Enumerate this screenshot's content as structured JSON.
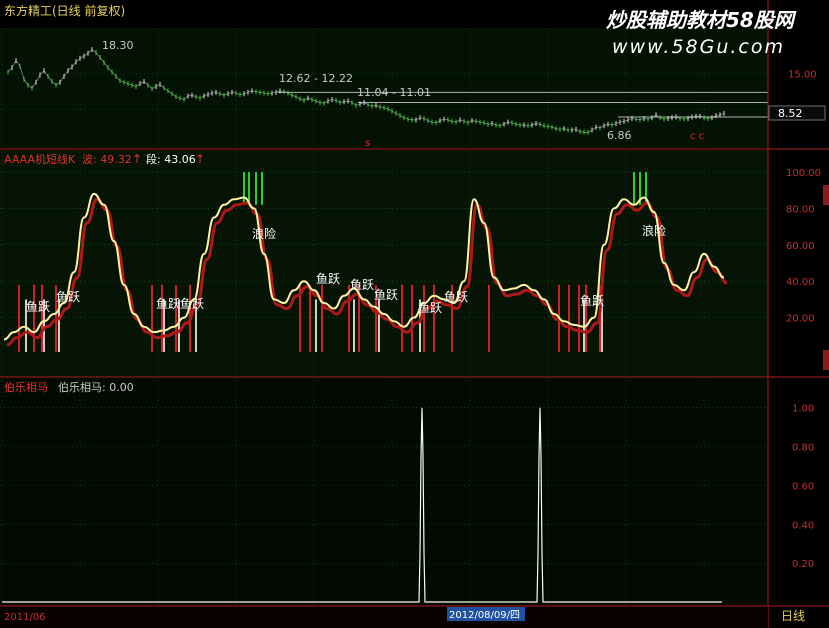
{
  "header": {
    "stock_title": "东方精工(日线 前复权)",
    "watermark_title": "炒股辅助教材58股网",
    "watermark_url": "www.58Gu.com"
  },
  "colors": {
    "background": "#000000",
    "panel_bg": "#051405",
    "grid": "#1f5a1f",
    "border": "#8b1a1a",
    "axis_text": "#c03030",
    "price_line": "#c8c8c8",
    "osc_main": "#fff3a0",
    "osc_shadow": "#b01818",
    "green_bar": "#33ff33",
    "white_bar": "#ffffff",
    "red_bar": "#d02020",
    "osc_label": "#e03030",
    "signal_line": "#f0fff0"
  },
  "price_panel": {
    "annotations": [
      {
        "id": "high",
        "text": "18.30"
      },
      {
        "id": "range1",
        "text": "12.62 - 12.22"
      },
      {
        "id": "range2",
        "text": "11.04 - 11.01"
      },
      {
        "id": "low",
        "text": "6.86"
      },
      {
        "id": "last",
        "text": "8.52"
      }
    ],
    "y_ticks": [
      "15.00",
      "10.00"
    ],
    "ylim": [
      5,
      21
    ]
  },
  "osc_panel": {
    "indicator_name": "AAAA机短线K",
    "indicator_label_value": "波: 49.32",
    "segment_label": "段: 43.06",
    "y_ticks": [
      "100.00",
      "80.00",
      "60.00",
      "40.00",
      "20.00"
    ],
    "ylim": [
      0,
      100
    ],
    "labels": [
      {
        "text": "鱼跃"
      },
      {
        "text": "鱼跃"
      },
      {
        "text": "鱼跃"
      },
      {
        "text": "鱼跃"
      },
      {
        "text": "浪险"
      },
      {
        "text": "鱼跃"
      },
      {
        "text": "鱼跃"
      },
      {
        "text": "鱼跃"
      },
      {
        "text": "鱼跃"
      },
      {
        "text": "鱼跃"
      },
      {
        "text": "鱼跃"
      },
      {
        "text": "浪险"
      }
    ]
  },
  "signal_panel": {
    "indicator_name": "伯乐相马",
    "value_label": "伯乐相马: 0.00",
    "y_ticks": [
      "1.00",
      "0.80",
      "0.60",
      "0.40",
      "0.20"
    ],
    "ylim": [
      0,
      1.05
    ]
  },
  "footer": {
    "date_left": "2011/06",
    "date_highlight": "2012/08/09/四",
    "period": "日线"
  },
  "chart_data": [
    {
      "type": "line",
      "name": "price",
      "ylim": [
        5,
        21
      ],
      "y_ticks": [
        15,
        10
      ],
      "x": [
        0,
        4,
        8,
        12,
        16,
        20,
        24,
        28,
        32,
        36,
        40,
        44,
        48,
        52,
        56,
        60,
        64,
        68,
        72,
        76,
        80,
        84,
        88,
        92,
        96,
        100,
        104,
        108,
        112,
        116,
        120,
        124,
        128,
        132,
        136,
        140,
        144,
        148,
        152,
        156,
        160,
        164,
        168,
        172,
        176,
        180,
        184,
        188,
        192,
        196,
        200,
        204,
        208,
        212,
        216,
        220,
        224,
        228,
        232,
        236,
        240,
        244,
        248,
        252,
        256,
        260,
        264,
        268,
        272,
        276,
        280,
        284,
        288,
        292,
        296,
        300,
        304,
        308,
        312,
        316,
        320,
        324,
        328,
        332,
        336,
        340,
        344,
        348,
        352,
        356,
        360,
        364,
        368,
        372,
        376,
        380,
        384,
        388,
        392,
        396,
        400,
        404,
        408,
        412,
        416,
        420,
        424,
        428,
        432,
        436,
        440,
        444,
        448,
        452,
        456,
        460,
        464,
        468,
        472,
        476,
        480,
        484,
        488,
        492,
        496,
        500,
        504,
        508,
        512,
        516,
        520,
        524,
        528,
        532,
        536,
        540,
        544,
        548,
        552,
        556,
        560,
        564,
        568,
        572,
        576,
        580,
        584,
        588,
        592,
        596,
        600,
        604,
        608,
        612,
        616,
        620,
        624,
        628,
        632,
        636,
        640,
        644,
        648,
        652,
        656,
        660,
        664,
        668,
        672,
        676,
        680,
        684,
        688,
        692,
        696,
        700,
        704,
        708,
        712,
        716,
        720
      ],
      "values": [
        15.2,
        15.8,
        16.8,
        16.0,
        14.2,
        13.4,
        13.0,
        13.8,
        14.8,
        15.4,
        14.6,
        13.9,
        13.4,
        13.8,
        14.6,
        15.4,
        15.9,
        16.6,
        17.1,
        17.4,
        17.8,
        18.3,
        17.9,
        17.2,
        16.5,
        15.8,
        15.2,
        14.6,
        14.0,
        13.8,
        13.6,
        13.4,
        13.2,
        13.6,
        13.9,
        13.4,
        12.9,
        13.2,
        13.5,
        13.0,
        12.6,
        12.2,
        11.8,
        11.6,
        11.4,
        11.9,
        12.0,
        11.8,
        11.6,
        11.9,
        12.1,
        12.3,
        12.4,
        12.2,
        12.0,
        12.2,
        12.4,
        12.3,
        12.1,
        12.2,
        12.4,
        12.6,
        12.5,
        12.4,
        12.3,
        12.2,
        12.3,
        12.4,
        12.6,
        12.5,
        12.3,
        12.0,
        11.8,
        11.5,
        11.3,
        11.6,
        11.4,
        11.2,
        11.0,
        10.9,
        11.2,
        11.4,
        11.3,
        11.0,
        11.1,
        11.2,
        11.0,
        10.6,
        10.8,
        11.0,
        10.7,
        10.5,
        10.6,
        10.4,
        10.3,
        10.1,
        9.8,
        9.5,
        9.2,
        8.9,
        8.7,
        8.6,
        8.6,
        8.9,
        8.8,
        8.5,
        8.3,
        8.2,
        8.5,
        8.7,
        8.6,
        8.4,
        8.3,
        8.6,
        8.4,
        8.2,
        8.5,
        8.4,
        8.3,
        8.2,
        8.0,
        8.1,
        7.9,
        7.8,
        8.0,
        8.3,
        8.2,
        8.0,
        7.9,
        7.9,
        7.8,
        7.9,
        8.1,
        8.0,
        7.8,
        7.7,
        7.6,
        7.4,
        7.3,
        7.4,
        7.2,
        7.2,
        7.3,
        7.0,
        6.9,
        6.86,
        7.2,
        7.6,
        7.5,
        7.8,
        8.0,
        7.9,
        8.1,
        8.3,
        8.4,
        8.6,
        8.8,
        8.7,
        8.6,
        8.8,
        8.7,
        8.9,
        9.3,
        8.9,
        8.7,
        8.8,
        8.9,
        9.0,
        8.8,
        8.7,
        8.8,
        9.0,
        9.1,
        9.1,
        8.9,
        8.8,
        8.9,
        9.2,
        9.3,
        9.5
      ],
      "annotations": [
        "18.30",
        "12.62 - 12.22",
        "11.04 - 11.01",
        "6.86",
        "8.52"
      ]
    },
    {
      "type": "line",
      "name": "AAAA机短线K",
      "ylim": [
        0,
        100
      ],
      "y_ticks": [
        100,
        80,
        60,
        40,
        20
      ],
      "x": [
        0,
        10,
        20,
        30,
        40,
        50,
        60,
        70,
        80,
        90,
        100,
        110,
        120,
        130,
        140,
        150,
        160,
        170,
        180,
        190,
        200,
        210,
        220,
        230,
        240,
        250,
        260,
        270,
        280,
        290,
        300,
        310,
        320,
        330,
        340,
        350,
        360,
        370,
        380,
        390,
        400,
        410,
        420,
        430,
        440,
        450,
        460,
        470,
        480,
        490,
        500,
        510,
        520,
        530,
        540,
        550,
        560,
        570,
        580,
        590,
        600,
        610,
        620,
        630,
        640,
        650,
        660,
        670,
        680,
        690,
        700,
        710,
        720
      ],
      "values": [
        8,
        12,
        15,
        12,
        18,
        22,
        28,
        45,
        75,
        88,
        82,
        62,
        38,
        22,
        15,
        12,
        13,
        15,
        20,
        30,
        55,
        75,
        82,
        85,
        86,
        80,
        55,
        30,
        28,
        35,
        40,
        35,
        28,
        25,
        32,
        36,
        30,
        26,
        22,
        18,
        15,
        20,
        28,
        32,
        30,
        28,
        40,
        85,
        72,
        42,
        35,
        36,
        38,
        35,
        30,
        22,
        18,
        16,
        15,
        20,
        60,
        80,
        85,
        82,
        86,
        78,
        50,
        38,
        35,
        45,
        55,
        48,
        42
      ],
      "last_value": 49.32,
      "segment_value": 43.06
    },
    {
      "type": "line",
      "name": "伯乐相马",
      "ylim": [
        0,
        1.05
      ],
      "y_ticks": [
        1.0,
        0.8,
        0.6,
        0.4,
        0.2
      ],
      "x": [
        0,
        417,
        418,
        419,
        420,
        421,
        422,
        423,
        535,
        536,
        537,
        538,
        539,
        540,
        541,
        720
      ],
      "values": [
        0,
        0,
        0.25,
        0.75,
        1.0,
        0.75,
        0.25,
        0,
        0,
        0.25,
        0.75,
        1.0,
        0.75,
        0.25,
        0,
        0
      ],
      "last_value": 0.0
    }
  ]
}
